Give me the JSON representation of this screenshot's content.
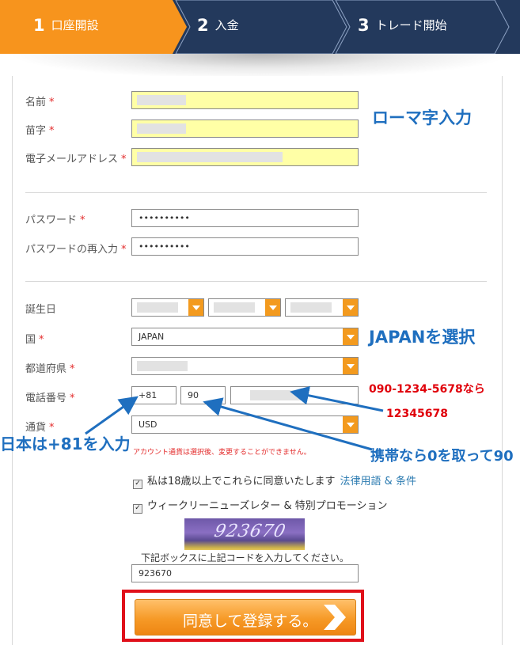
{
  "steps": [
    {
      "num": "1",
      "label": "口座開設"
    },
    {
      "num": "2",
      "label": "入金"
    },
    {
      "num": "3",
      "label": "トレード開始"
    }
  ],
  "colors": {
    "active_step": "#f7941d",
    "inactive_step": "#23395c",
    "accent_orange": "#f39a1e",
    "annotation_blue": "#1f6fbf",
    "annotation_red": "#e0000a"
  },
  "form": {
    "required_mark": "*",
    "first_name_label": "名前",
    "last_name_label": "苗字",
    "email_label": "電子メールアドレス",
    "password_label": "パスワード",
    "password_value": "••••••••••",
    "password_confirm_label": "パスワードの再入力",
    "password_confirm_value": "••••••••••",
    "birthdate_label": "誕生日",
    "country_label": "国",
    "country_value": "JAPAN",
    "prefecture_label": "都道府県",
    "phone_label": "電話番号",
    "phone_country_code": "+81",
    "phone_area_code": "90",
    "currency_label": "通貨",
    "currency_value": "USD",
    "currency_note": "アカウント通貨は選択後、変更することができません。",
    "age_agree_text": "私は18歳以上でこれらに同意いたします",
    "terms_link": "法律用語 & 条件",
    "newsletter_text": "ウィークリーニューズレター & 特別プロモーション",
    "checkbox_mark": "✓",
    "captcha_text": "923670",
    "captcha_instruction": "下記ボックスに上記コードを入力してください。",
    "captcha_input_value": "923670",
    "submit_label": "同意して登録する。"
  },
  "annotations": {
    "romaji": "ローマ字入力",
    "japan_select": "JAPANを選択",
    "phone_example": "090-1234-5678なら",
    "phone_result": "12345678",
    "country_code_hint": "日本は+81を入力",
    "mobile_hint": "携帯なら0を取って90"
  }
}
